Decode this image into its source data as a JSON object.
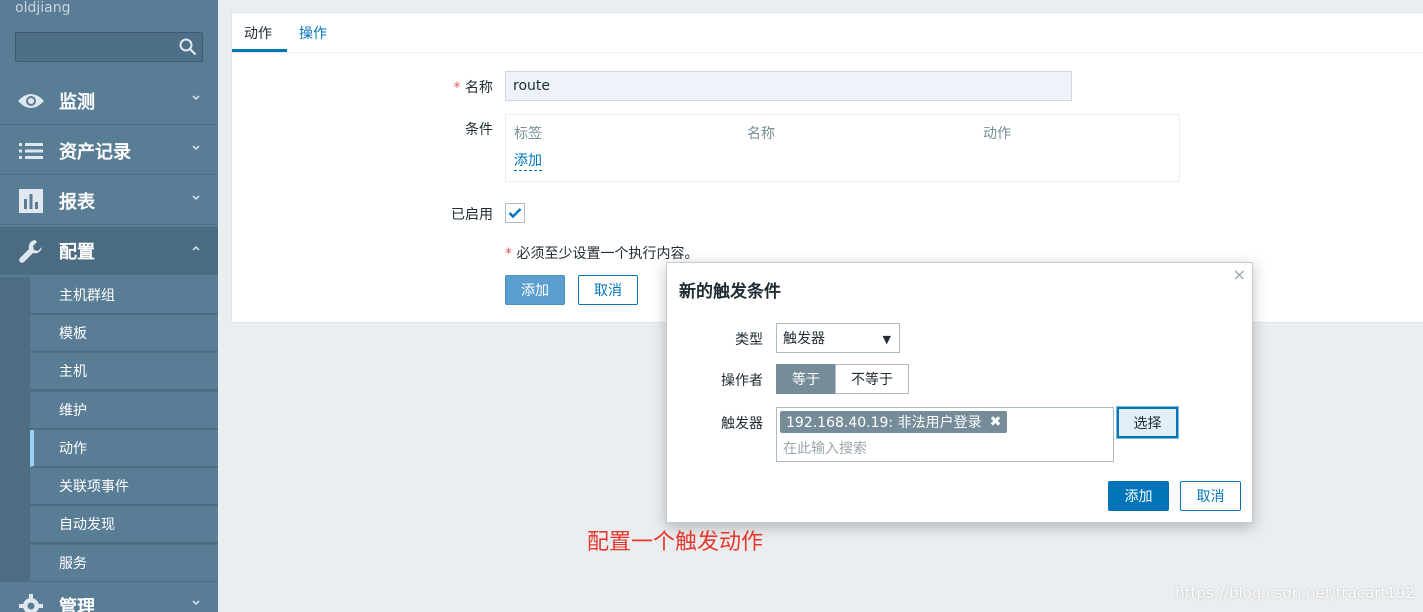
{
  "sidebar": {
    "username": "oldjiang",
    "search": {
      "value": "",
      "placeholder": ""
    },
    "menu": [
      {
        "label": "监测",
        "icon": "eye-icon"
      },
      {
        "label": "资产记录",
        "icon": "list-icon"
      },
      {
        "label": "报表",
        "icon": "bar-chart-icon"
      },
      {
        "label": "配置",
        "icon": "wrench-icon"
      },
      {
        "label": "管理",
        "icon": "gear-icon"
      }
    ],
    "submenu": [
      "主机群组",
      "模板",
      "主机",
      "维护",
      "动作",
      "关联项事件",
      "自动发现",
      "服务"
    ],
    "current_submenu": "动作"
  },
  "tabs": [
    "动作",
    "操作"
  ],
  "form": {
    "required_mark": "*",
    "name_label": "名称",
    "name_value": "route",
    "conditions_label": "条件",
    "conditions_headers": [
      "标签",
      "名称",
      "动作"
    ],
    "conditions_add": "添加",
    "enabled_label": "已启用",
    "enabled": true,
    "note": "必须至少设置一个执行内容。",
    "add_button": "添加",
    "cancel_button": "取消"
  },
  "dialog": {
    "title": "新的触发条件",
    "close": "×",
    "type_label": "类型",
    "type_value": "触发器",
    "type_arrow": "▼",
    "operator_label": "操作者",
    "operator_options": [
      "等于",
      "不等于"
    ],
    "operator_selected": "等于",
    "trigger_label": "触发器",
    "trigger_chip": "192.168.40.19: 非法用户登录",
    "trigger_chip_remove": "✖",
    "trigger_placeholder": "在此输入搜索",
    "select_button": "选择",
    "add_button": "添加",
    "cancel_button": "取消"
  },
  "annotation": "配置一个触发动作",
  "watermark": "https://blog.csdn.net/tracart192",
  "colors": {
    "accent": "#0275b8",
    "sidebar": "#5a7d96",
    "annotation": "#e8372c"
  }
}
